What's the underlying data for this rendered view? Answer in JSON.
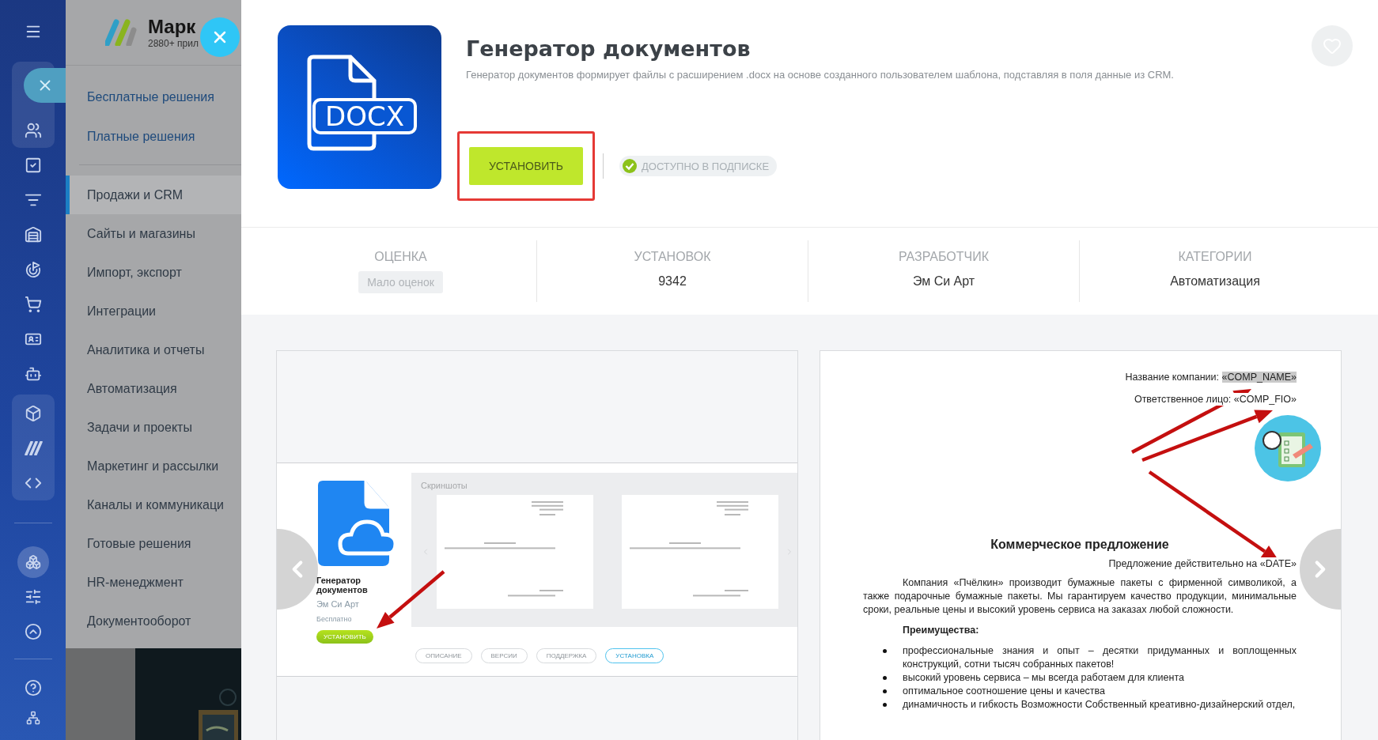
{
  "catalog": {
    "title": "Марк",
    "subtitle": "2880+ прил",
    "links": [
      "Бесплатные решения",
      "Платные решения"
    ],
    "categories": [
      {
        "label": "Продажи и CRM",
        "selected": true
      },
      {
        "label": "Сайты и магазины",
        "selected": false
      },
      {
        "label": "Импорт, экспорт",
        "selected": false
      },
      {
        "label": "Интеграции",
        "selected": false
      },
      {
        "label": "Аналитика и отчеты",
        "selected": false
      },
      {
        "label": "Автоматизация",
        "selected": false
      },
      {
        "label": "Задачи и проекты",
        "selected": false
      },
      {
        "label": "Маркетинг и рассылки",
        "selected": false
      },
      {
        "label": "Каналы и коммуникаци",
        "selected": false
      },
      {
        "label": "Готовые решения",
        "selected": false
      },
      {
        "label": "HR-менеджмент",
        "selected": false
      },
      {
        "label": "Документооборот",
        "selected": false
      }
    ]
  },
  "app": {
    "icon_label": "DOCX",
    "title": "Генератор документов",
    "description": "Генератор документов формирует файлы с расширением .docx на основе созданного пользователем шаблона, подставляя в поля данные из CRM.",
    "install_button": "УСТАНОВИТЬ",
    "install_highlighted": true,
    "badge": "ДОСТУПНО В ПОДПИСКЕ",
    "stats": [
      {
        "label": "ОЦЕНКА",
        "value": "Мало оценок",
        "kind": "chip"
      },
      {
        "label": "УСТАНОВОК",
        "value": "9342",
        "kind": "text"
      },
      {
        "label": "РАЗРАБОТЧИК",
        "value": "Эм Си Арт",
        "kind": "text"
      },
      {
        "label": "КАТЕГОРИИ",
        "value": "Автоматизация",
        "kind": "text"
      }
    ]
  },
  "screenshots": [
    {
      "kind": "app_page",
      "title": "Генератор документов",
      "developer": "Эм Си Арт",
      "price": "Бесплатно",
      "install_button": "УСТАНОВИТЬ",
      "gallery_title": "Скриншоты",
      "tabs": [
        {
          "label": "ОПИСАНИЕ",
          "selected": false
        },
        {
          "label": "ВЕРСИИ",
          "selected": false
        },
        {
          "label": "ПОДДЕРЖКА",
          "selected": false
        },
        {
          "label": "УСТАНОВКА",
          "selected": true
        }
      ]
    },
    {
      "kind": "document",
      "fields": [
        {
          "label": "Название компании:",
          "value": "«COMP_NAME»",
          "highlighted": true
        },
        {
          "label": "Ответственное лицо:",
          "value": "«COMP_FIO»",
          "highlighted": false
        }
      ],
      "heading": "Коммерческое предложение",
      "validity": "Предложение действительно на «DATE»",
      "paragraph": "Компания «Пчёлкин» производит бумажные пакеты с фирменной символикой, а также подарочные бумажные пакеты. Мы гарантируем качество продукции, минимальные сроки, реальные цены и высокий уровень сервиса на заказах любой сложности.",
      "subheading": "Преимущества:",
      "bullets": [
        "профессиональные знания и опыт – десятки придуманных и воплощенных конструкций, сотни тысяч собранных пакетов!",
        "высокий уровень сервиса – мы всегда работаем для клиента",
        "оптимальное соотношение цены и качества",
        "динамичность и гибкость Возможности Собственный креативно-дизайнерский отдел,"
      ]
    }
  ]
}
